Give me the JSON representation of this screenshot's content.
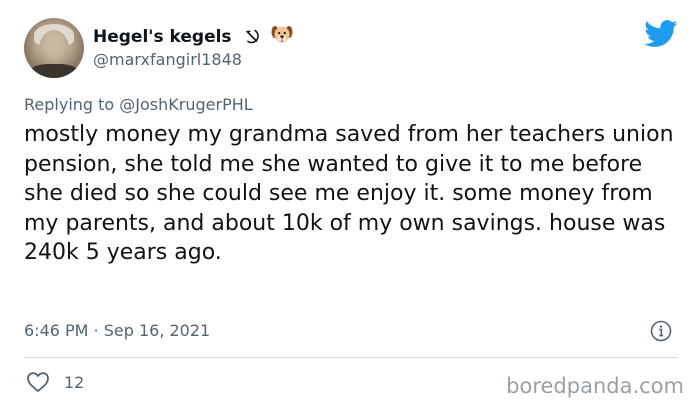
{
  "author": {
    "display_name": "Hegel's kegels",
    "name_emojis": [
      "hammer-sickle-icon",
      "dog-face-icon"
    ],
    "handle": "@marxfangirl1848"
  },
  "reply": {
    "prefix": "Replying to",
    "mention": "@JoshKrugerPHL"
  },
  "tweet": {
    "text": "mostly money my grandma saved from her teachers union pension, she told me she wanted to give it to me before she died so she could see me enjoy it. some money from my parents, and about 10k of my own savings. house was 240k 5 years ago.",
    "timestamp": "6:46 PM · Sep 16, 2021",
    "like_count": "12"
  },
  "icons": {
    "brand": "twitter-bird-icon",
    "info": "info-icon",
    "like": "heart-icon"
  },
  "watermark": "boredpanda.com",
  "colors": {
    "twitter_blue": "#1d9bf0",
    "secondary_text": "#536471",
    "primary_text": "#0f1419",
    "divider": "#cfd9de",
    "watermark": "#9aa0a6"
  }
}
